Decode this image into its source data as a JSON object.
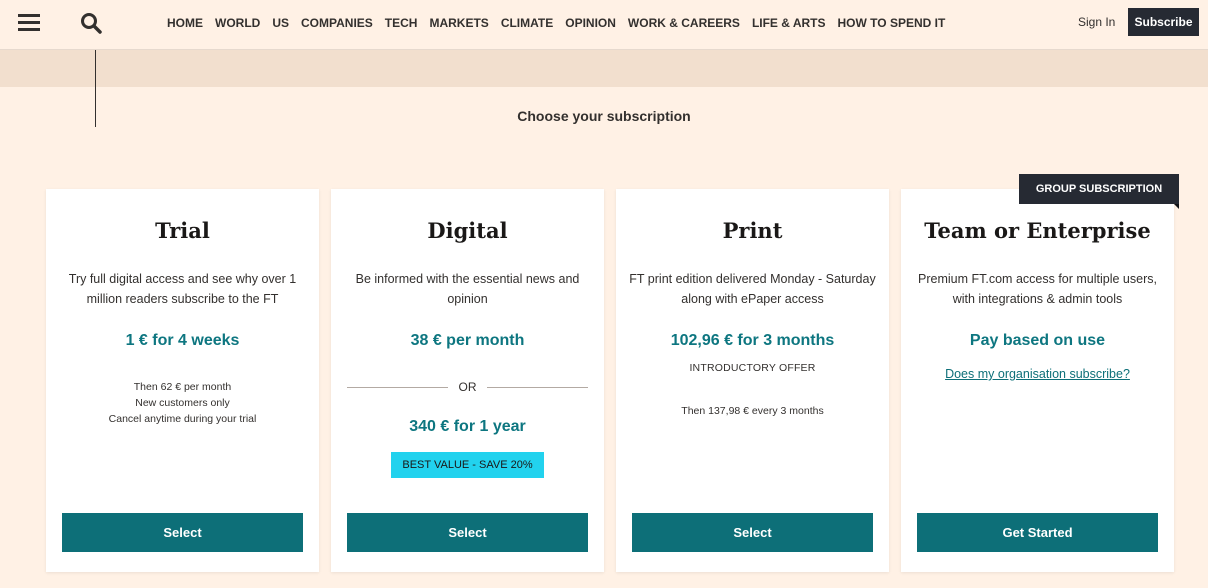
{
  "header": {
    "menu_icon": "hamburger-icon",
    "search_icon": "search-icon",
    "nav": [
      "HOME",
      "WORLD",
      "US",
      "COMPANIES",
      "TECH",
      "MARKETS",
      "CLIMATE",
      "OPINION",
      "WORK & CAREERS",
      "LIFE & ARTS",
      "HOW TO SPEND IT"
    ],
    "sign_in": "Sign In",
    "subscribe": "Subscribe"
  },
  "page": {
    "heading": "Choose your subscription",
    "group_badge": "GROUP SUBSCRIPTION"
  },
  "plans": [
    {
      "title": "Trial",
      "description": "Try full digital access and see why over 1 million readers subscribe to the FT",
      "price": "1 € for 4 weeks",
      "notes": [
        "Then 62 € per month",
        "New customers only",
        "Cancel anytime during your trial"
      ],
      "button": "Select"
    },
    {
      "title": "Digital",
      "description": "Be informed with the essential news and opinion",
      "price": "38 € per month",
      "or": "OR",
      "price_alt": "340 € for 1 year",
      "badge": "BEST VALUE - SAVE 20%",
      "button": "Select"
    },
    {
      "title": "Print",
      "description": "FT print edition delivered Monday - Saturday along with ePaper access",
      "price": "102,96 € for 3 months",
      "offer": "INTRODUCTORY OFFER",
      "notes": [
        "Then 137,98 € every 3 months"
      ],
      "button": "Select"
    },
    {
      "title": "Team or Enterprise",
      "description": "Premium FT.com access for multiple users, with integrations & admin tools",
      "price": "Pay based on use",
      "link": "Does my organisation subscribe?",
      "button": "Get Started"
    }
  ],
  "colors": {
    "background": "#fff1e5",
    "band": "#f2dfce",
    "accent_teal": "#0d6f78",
    "dark": "#262a33",
    "best_value_badge": "#22d2ee"
  }
}
